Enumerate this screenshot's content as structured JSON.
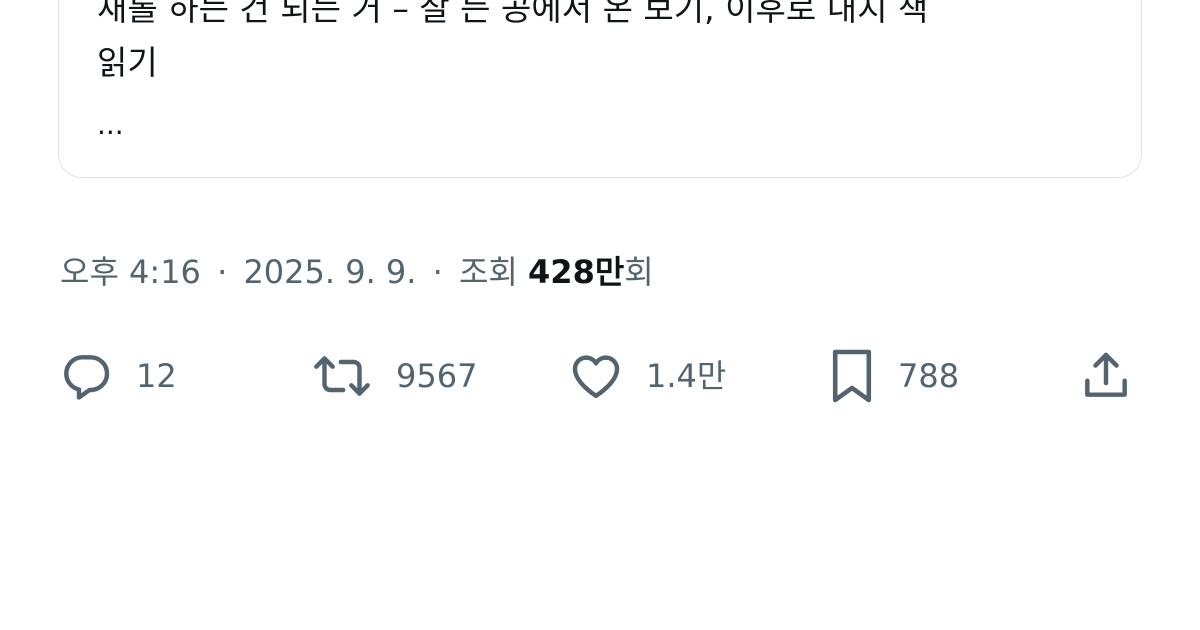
{
  "quote": {
    "line1": "새롤 하는 건 되는 거 – 잘 든 공에서 온 보기, 이후로 내지 책",
    "line2": "읽기",
    "line3": "..."
  },
  "meta": {
    "time": "오후 4:16",
    "separator": "·",
    "date": "2025. 9. 9.",
    "views_label": "조회",
    "views_count": "428만",
    "views_suffix": "회"
  },
  "actions": {
    "reply": {
      "icon": "reply-icon",
      "count": "12"
    },
    "retweet": {
      "icon": "retweet-icon",
      "count": "9567"
    },
    "like": {
      "icon": "heart-icon",
      "count": "1.4만"
    },
    "bookmark": {
      "icon": "bookmark-icon",
      "count": "788"
    },
    "share": {
      "icon": "share-icon"
    }
  },
  "colors": {
    "text_primary": "#0f1419",
    "text_secondary": "#536471",
    "border": "#dfe3e7"
  }
}
